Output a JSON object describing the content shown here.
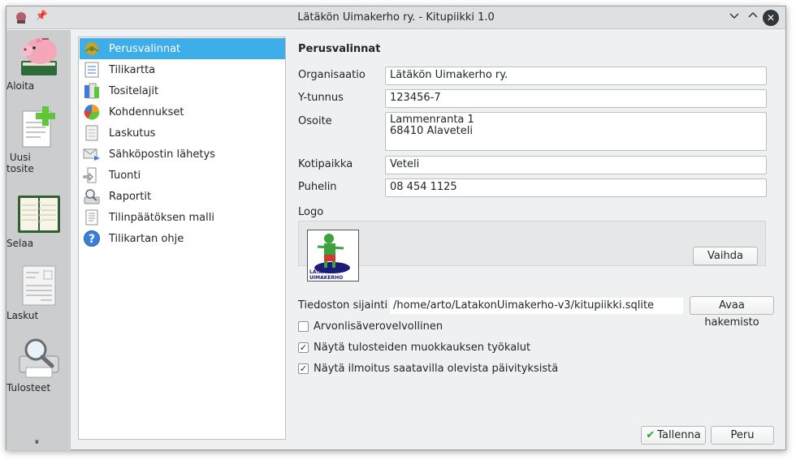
{
  "window": {
    "title": "Lätäkön Uimakerho ry. - Kitupiikki 1.0",
    "controls": [
      "minimize-icon",
      "maximize-icon",
      "close-icon"
    ]
  },
  "sidebar": {
    "items": [
      {
        "label": "Aloita",
        "icon": "piggy-bank-icon"
      },
      {
        "label": "Uusi\ntosite",
        "icon": "new-document-icon"
      },
      {
        "label": "Selaa",
        "icon": "ledger-book-icon"
      },
      {
        "label": "Laskut",
        "icon": "invoice-icon"
      },
      {
        "label": "Tulosteet",
        "icon": "printer-magnifier-icon"
      }
    ],
    "more": "»"
  },
  "nav": {
    "items": [
      {
        "label": "Perusvalinnat",
        "icon": "settings-icon",
        "active": true
      },
      {
        "label": "Tilikartta",
        "icon": "chart-of-accounts-icon"
      },
      {
        "label": "Tositelajit",
        "icon": "document-types-icon"
      },
      {
        "label": "Kohdennukset",
        "icon": "pie-chart-icon"
      },
      {
        "label": "Laskutus",
        "icon": "invoice-icon"
      },
      {
        "label": "Sähköpostin lähetys",
        "icon": "email-send-icon"
      },
      {
        "label": "Tuonti",
        "icon": "import-icon"
      },
      {
        "label": "Raportit",
        "icon": "report-icon"
      },
      {
        "label": "Tilinpäätöksen malli",
        "icon": "template-icon"
      },
      {
        "label": "Tilikartan ohje",
        "icon": "help-icon"
      }
    ]
  },
  "form": {
    "heading": "Perusvalinnat",
    "organisation_label": "Organisaatio",
    "organisation_value": "Lätäkön Uimakerho ry.",
    "business_id_label": "Y-tunnus",
    "business_id_value": "123456-7",
    "address_label": "Osoite",
    "address_value": "Lammenranta 1\n68410 Alaveteli",
    "city_label": "Kotipaikka",
    "city_value": "Veteli",
    "phone_label": "Puhelin",
    "phone_value": "08 454 1125",
    "logo_label": "Logo",
    "logo_text": "LATAKON UIMAKERHO",
    "change_logo_button": "Vaihda",
    "file_location_label": "Tiedoston sijainti",
    "file_location_value": "/home/arto/LatakonUimakerho-v3/kitupiikki.sqlite",
    "open_folder_button": "Avaa hakemisto",
    "vat_checkbox_label": "Arvonlisäverovelvollinen",
    "vat_checked": false,
    "print_tools_checkbox_label": "Näytä tulosteiden muokkauksen työkalut",
    "print_tools_checked": true,
    "updates_checkbox_label": "Näytä ilmoitus saatavilla olevista päivityksistä",
    "updates_checked": true,
    "save_button": "Tallenna",
    "cancel_button": "Peru"
  },
  "colors": {
    "accent": "#3daee9",
    "sidebar_bg": "#cbcdcf",
    "window_bg": "#eff0f1",
    "save_check": "#2ca02c"
  }
}
